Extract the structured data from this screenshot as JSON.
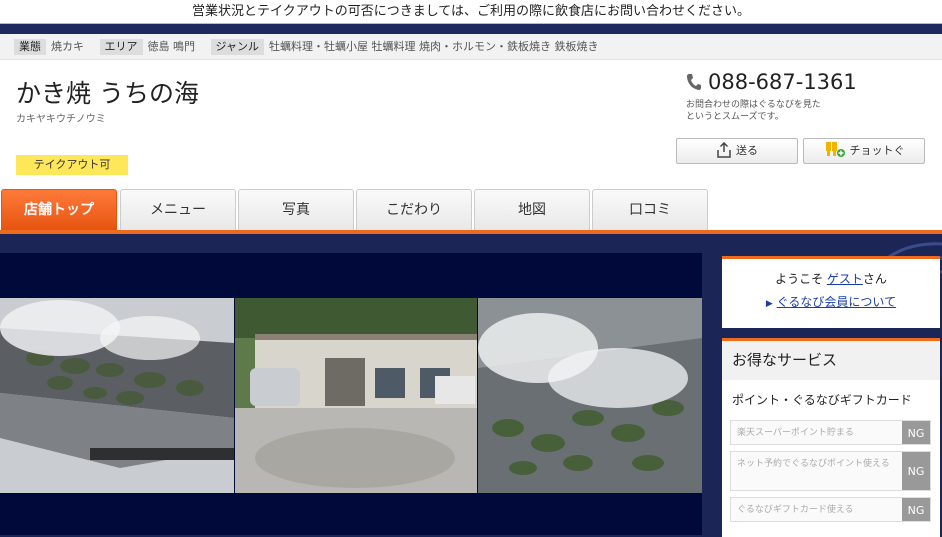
{
  "notice": "営業状況とテイクアウトの可否につきましては、ご利用の際に飲食店にお問い合わせください。",
  "tags": [
    {
      "label": "業態",
      "value": "焼カキ"
    },
    {
      "label": "エリア",
      "value": "徳島 鳴門"
    },
    {
      "label": "ジャンル",
      "value": "牡蠣料理・牡蠣小屋 牡蠣料理 焼肉・ホルモン・鉄板焼き 鉄板焼き"
    }
  ],
  "shop": {
    "name": "かき焼 うちの海",
    "kana": "カキヤキウチノウミ",
    "takeout_badge": "テイクアウト可"
  },
  "contact": {
    "phone": "088-687-1361",
    "note_line1": "お問合わせの際はぐるなびを見た",
    "note_line2": "というとスムーズです。",
    "send_label": "送る",
    "chotto_label": "チョットぐ"
  },
  "tabs": [
    "店舗トップ",
    "メニュー",
    "写真",
    "こだわり",
    "地図",
    "口コミ"
  ],
  "welcome": {
    "prefix": "ようこそ ",
    "guest": "ゲスト",
    "suffix": "さん",
    "member_link": "ぐるなび会員について"
  },
  "service": {
    "title": "お得なサービス",
    "subtitle": "ポイント・ぐるなびギフトカード",
    "items": [
      {
        "text": "楽天スーパーポイント貯まる",
        "status": "NG"
      },
      {
        "text": "ネット予約でぐるなびポイント使える",
        "status": "NG"
      },
      {
        "text": "ぐるなびギフトカード使える",
        "status": "NG"
      }
    ]
  },
  "colors": {
    "accent": "#ee6a1c",
    "navy": "#1c2656",
    "badge": "#ffe75a"
  }
}
